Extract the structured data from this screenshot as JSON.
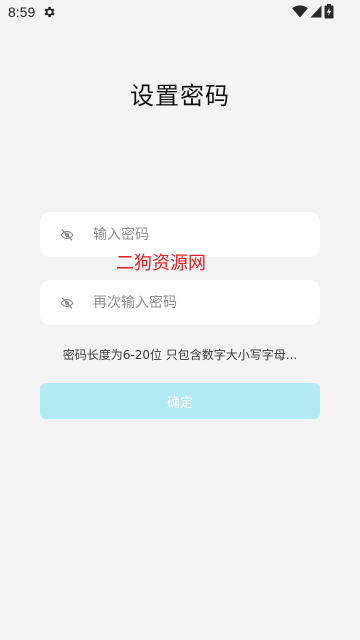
{
  "status_bar": {
    "time": "8:59",
    "icons": [
      "gear-icon",
      "wifi-icon",
      "signal-icon",
      "battery-icon"
    ]
  },
  "page": {
    "title": "设置密码"
  },
  "password_field": {
    "placeholder": "输入密码",
    "value": "",
    "icon": "eye-off-icon"
  },
  "confirm_password_field": {
    "placeholder": "再次输入密码",
    "value": "",
    "icon": "eye-off-icon"
  },
  "watermark": "二狗资源网",
  "hint": "密码长度为6-20位 只包含数字大小写字母...",
  "confirm_button": {
    "label": "确定",
    "color": "#b3ebf2",
    "enabled": false
  },
  "colors": {
    "background": "#f4f4f4",
    "field_background": "#ffffff",
    "watermark": "#e52121"
  }
}
